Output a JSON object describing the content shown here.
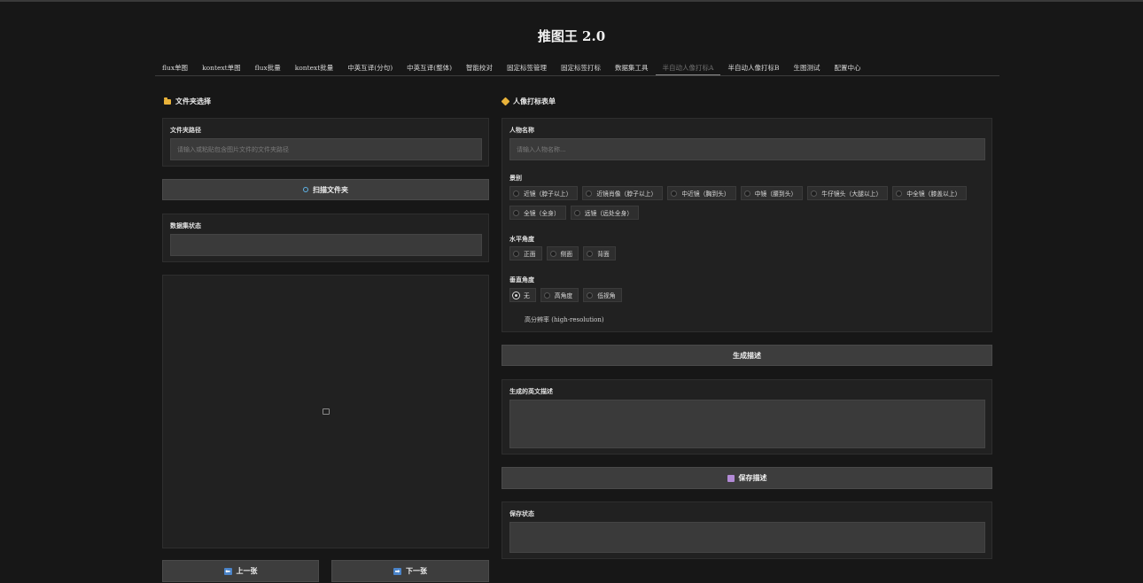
{
  "app": {
    "title": "推图王 2.0"
  },
  "tabs": [
    {
      "label": "flux单图"
    },
    {
      "label": "kontext单图"
    },
    {
      "label": "flux批量"
    },
    {
      "label": "kontext批量"
    },
    {
      "label": "中英互译(分句)"
    },
    {
      "label": "中英互译(整体)"
    },
    {
      "label": "智能校对"
    },
    {
      "label": "固定标签管理"
    },
    {
      "label": "固定标签打标"
    },
    {
      "label": "数据集工具"
    },
    {
      "label": "半自动人像打标A",
      "active": true
    },
    {
      "label": "半自动人像打标B"
    },
    {
      "label": "生图测试"
    },
    {
      "label": "配置中心"
    }
  ],
  "left": {
    "section_title": "文件夹选择",
    "section_icon": "folder-icon",
    "folder_path": {
      "label": "文件夹路径",
      "placeholder": "请输入或粘贴包含图片文件的文件夹路径",
      "value": ""
    },
    "scan_button": {
      "label": "扫描文件夹",
      "icon": "search-icon"
    },
    "dataset_status": {
      "label": "数据集状态",
      "value": ""
    },
    "image_preview": {
      "icon": "image-icon"
    },
    "prev_button": {
      "label": "上一张",
      "icon": "arrow-left-icon"
    },
    "next_button": {
      "label": "下一张",
      "icon": "arrow-right-icon"
    }
  },
  "right": {
    "section_title": "人像打标表单",
    "section_icon": "tag-icon",
    "person_name": {
      "label": "人物名称",
      "placeholder": "请输入人物名称...",
      "value": ""
    },
    "shot": {
      "label": "景别",
      "options": [
        "近镜（脖子以上）",
        "近镜肖像（脖子以上）",
        "中近镜（胸到头）",
        "中镜（腰到头）",
        "牛仔镜头（大腿以上）",
        "中全镜（膝盖以上）",
        "全镜（全身）",
        "远镜（远处全身）"
      ],
      "selected": null
    },
    "horizontal_angle": {
      "label": "水平角度",
      "options": [
        "正面",
        "侧面",
        "背面"
      ],
      "selected": null
    },
    "vertical_angle": {
      "label": "垂直角度",
      "options": [
        "无",
        "高角度",
        "低视角"
      ],
      "selected": "无"
    },
    "high_res": {
      "label": "高分辨率 (high-resolution)",
      "checked": false
    },
    "generate_button": {
      "label": "生成描述"
    },
    "english_desc": {
      "label": "生成的英文描述",
      "value": ""
    },
    "save_button": {
      "label": "保存描述",
      "icon": "save-icon"
    },
    "save_status": {
      "label": "保存状态",
      "value": ""
    }
  },
  "colors": {
    "background": "#171717",
    "panel": "#212121",
    "input": "#3a3a3a",
    "button": "#3d3d3d",
    "accent_folder": "#e8b23a"
  }
}
